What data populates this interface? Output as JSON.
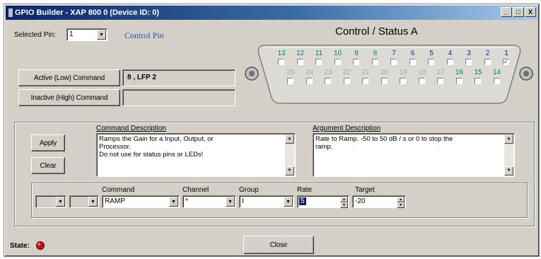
{
  "window": {
    "title": "GPIO Builder - XAP 800 0 (Device ID: 0)",
    "controls": [
      "_",
      "□",
      "X"
    ]
  },
  "selected_pin": {
    "label": "Selected Pin:",
    "value": "1",
    "type_label": "Control Pin"
  },
  "commands": {
    "active_label": "Active (Low) Command",
    "active_value": "8 , LFP 2",
    "inactive_label": "Inactive (High) Command",
    "inactive_value": ""
  },
  "connector": {
    "title": "Control / Status A",
    "top_pins": [
      "13",
      "12",
      "11",
      "10",
      "9",
      "8",
      "7",
      "6",
      "5",
      "4",
      "3",
      "2",
      "1"
    ],
    "bottom_pins": [
      "25",
      "24",
      "23",
      "22",
      "21",
      "20",
      "19",
      "18",
      "17",
      "16",
      "15",
      "14"
    ],
    "checked_pins": [
      "1"
    ],
    "colors": {
      "control": "#008080",
      "status": "#2020a0",
      "inactive": "#a8a8a8"
    }
  },
  "actions": {
    "apply": "Apply",
    "clear": "Clear",
    "close": "Close"
  },
  "command_description": {
    "label": "Command Description",
    "text": "Ramps the Gain for a Input, Output, or\nProcessor.\nDo not use for status pins or LEDs!"
  },
  "argument_description": {
    "label": "Argument Description",
    "text": "Rate to Ramp.  -50 to 50 dB / s or 0 to stop the\nramp."
  },
  "fields": {
    "command_label": "Command",
    "command_value": "RAMP",
    "channel_label": "Channel",
    "channel_value": "*",
    "group_label": "Group",
    "group_value": "I",
    "rate_label": "Rate",
    "rate_value": "5",
    "target_label": "Target",
    "target_value": "-20"
  },
  "state": {
    "label": "State:",
    "indicator_color": "#cc1111"
  }
}
